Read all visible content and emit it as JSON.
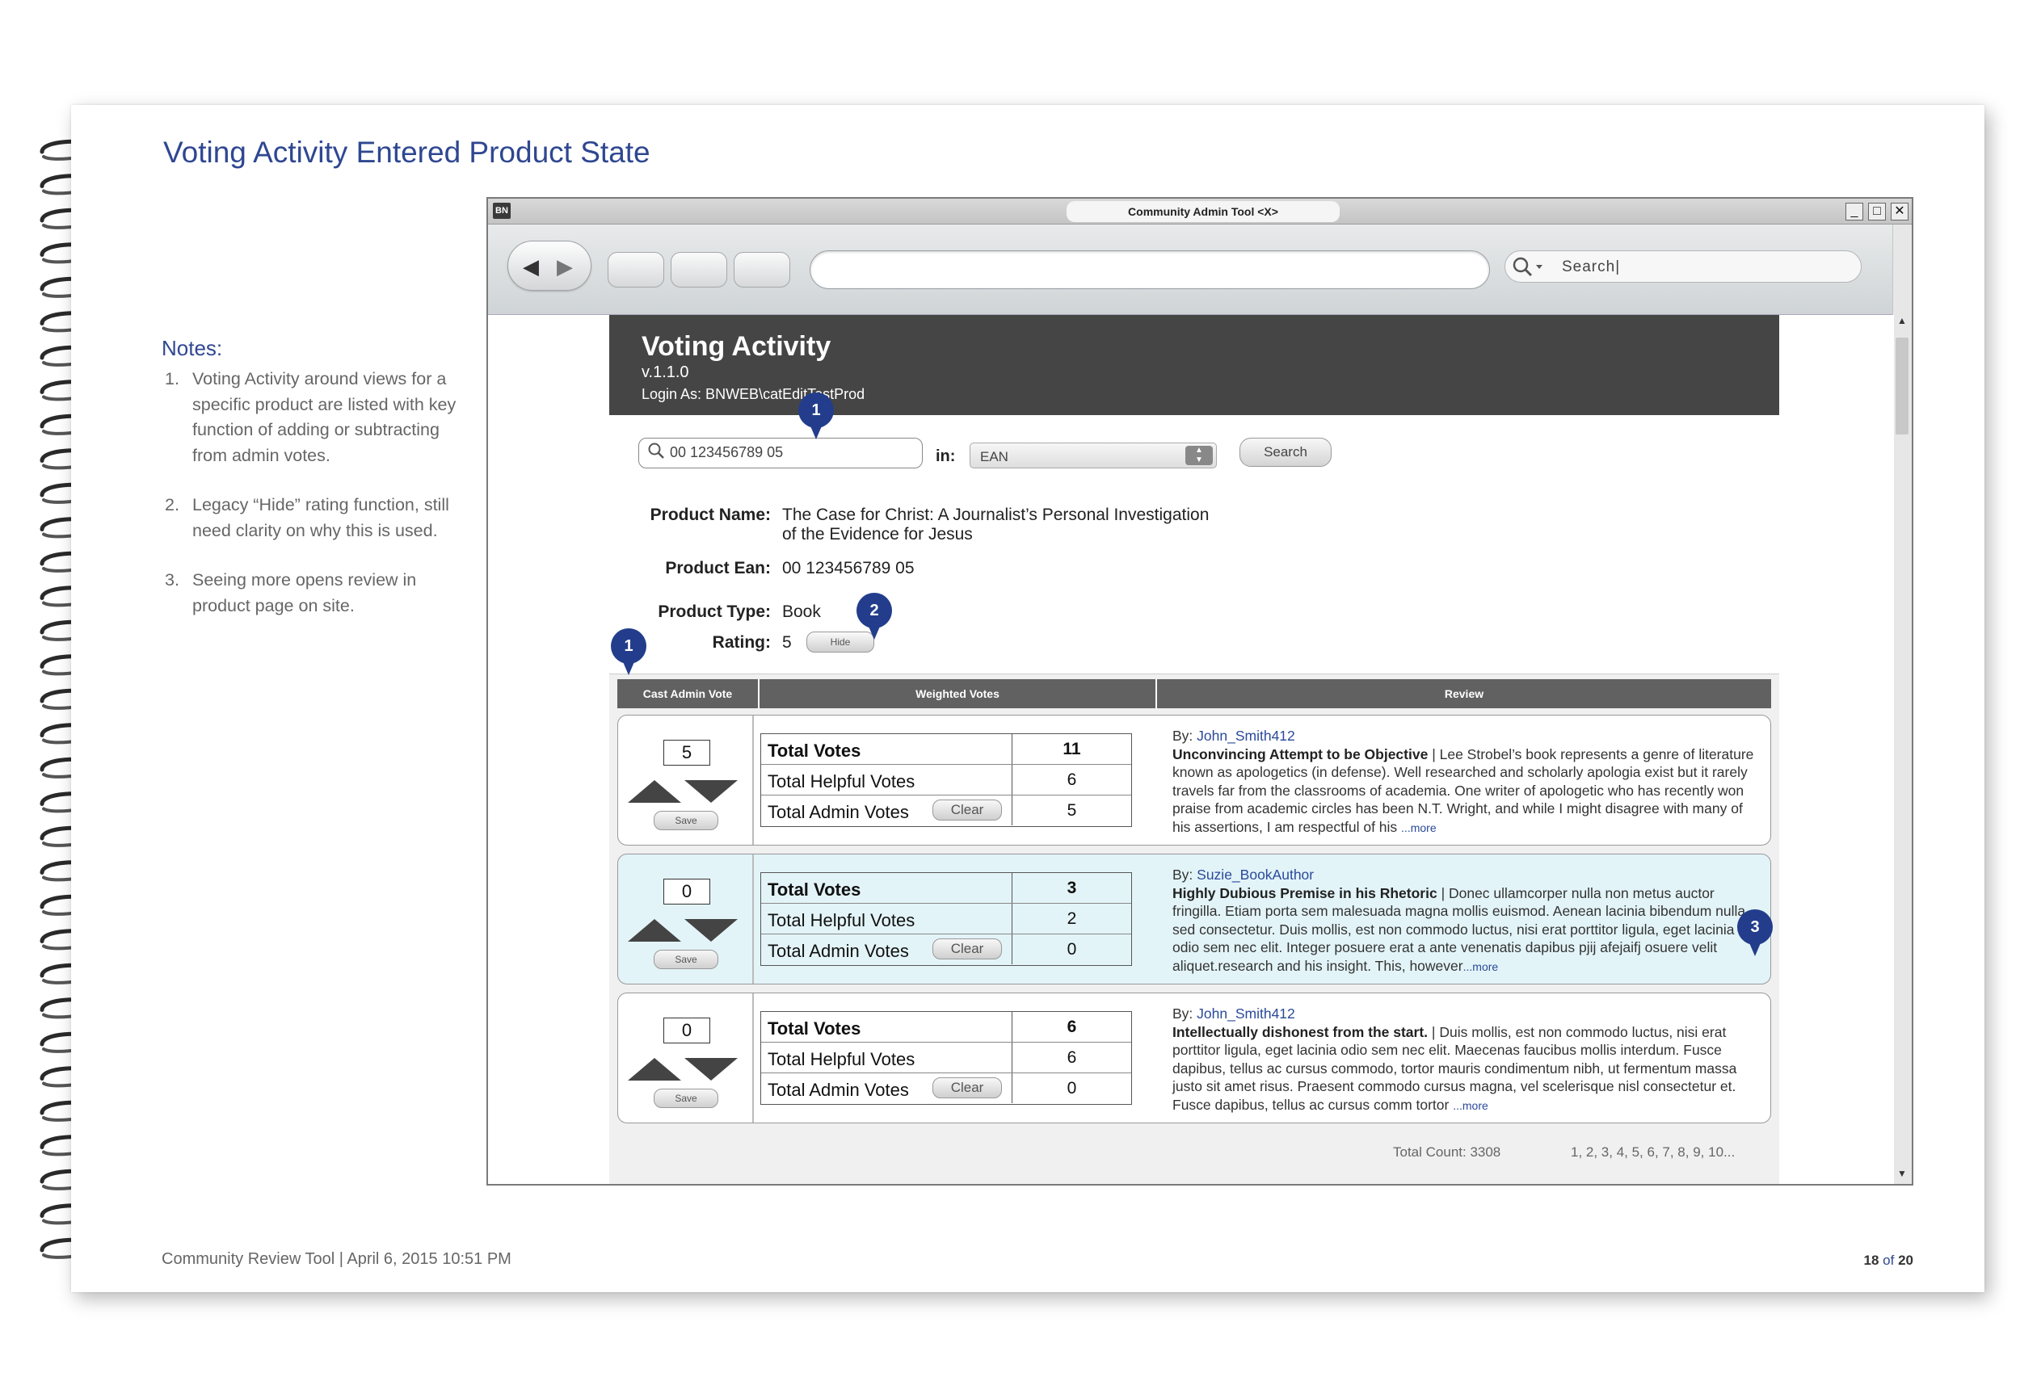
{
  "document": {
    "title": "Voting Activity Entered Product State",
    "notes_title": "Notes:",
    "notes": [
      {
        "num": "1.",
        "text": "Voting Activity around views for a specific product are listed with key function of adding or subtracting from admin votes."
      },
      {
        "num": "2.",
        "text": "Legacy “Hide” rating function, still need clarity on why this is used."
      },
      {
        "num": "3.",
        "text": "Seeing more opens review in product page on site."
      }
    ],
    "footer_left": "Community Review Tool | April 6, 2015 10:51 PM",
    "page_current": "18",
    "page_of": "of",
    "page_total": "20"
  },
  "window": {
    "app_icon": "BN",
    "title": "Community Admin Tool <X>",
    "minimize": "_",
    "maximize": "□",
    "close": "✕",
    "search_placeholder": "Search|"
  },
  "app": {
    "title": "Voting Activity",
    "version": "v.1.1.0",
    "login": "Login As: BNWEB\\catEditTestProd",
    "search_value": "00 123456789 05",
    "in_label": "in:",
    "search_type": "EAN",
    "search_button": "Search",
    "product_name_label": "Product Name:",
    "product_name_line1": "The Case for Christ: A Journalist’s Personal Investigation",
    "product_name_line2": "of the Evidence for Jesus",
    "product_ean_label": "Product Ean:",
    "product_ean": "00 123456789 05",
    "product_type_label": "Product Type:",
    "product_type": "Book",
    "rating_label": "Rating:",
    "rating": "5",
    "hide_button": "Hide",
    "columns": [
      "Cast Admin Vote",
      "Weighted Votes",
      "Review"
    ],
    "total_votes_label": "Total Votes",
    "helpful_votes_label": "Total Helpful Votes",
    "admin_votes_label": "Total Admin Votes",
    "clear_button": "Clear",
    "save_button": "Save",
    "by_prefix": "By: ",
    "more_link": "...more",
    "rows": [
      {
        "admin_vote": "5",
        "total_votes": "11",
        "helpful_votes": "6",
        "admin_votes": "5",
        "author": "John_Smith412",
        "headline": "Unconvincing Attempt to be Objective",
        "body": " | Lee Strobel’s book represents a genre of literature known as apologetics (in defense). Well researched and scholarly apologia exist but it rarely travels far from the classrooms of academia. One writer of apologetic who has recently won praise from academic circles has been N.T. Wright, and while I might disagree with many of his assertions, I am respectful of his "
      },
      {
        "admin_vote": "0",
        "total_votes": "3",
        "helpful_votes": "2",
        "admin_votes": "0",
        "author": "Suzie_BookAuthor",
        "headline": "Highly Dubious Premise in his Rhetoric",
        "body": " | Donec ullamcorper nulla non metus auctor fringilla. Etiam porta sem malesuada magna mollis euismod. Aenean lacinia bibendum nulla sed consectetur. Duis mollis, est non commodo luctus, nisi erat porttitor ligula, eget lacinia odio sem nec elit. Integer posuere erat a ante venenatis dapibus pjij afejaifj osuere velit aliquet.research and his insight. This, however"
      },
      {
        "admin_vote": "0",
        "total_votes": "6",
        "helpful_votes": "6",
        "admin_votes": "0",
        "author": "John_Smith412",
        "headline": "Intellectually dishonest from the start.",
        "body": " | Duis mollis, est non commodo luctus, nisi erat porttitor ligula, eget lacinia odio sem nec elit. Maecenas faucibus mollis interdum. Fusce dapibus, tellus ac cursus commodo, tortor mauris condimentum nibh, ut fermentum massa justo sit amet risus. Praesent commodo cursus magna, vel scelerisque nisl consectetur et. Fusce dapibus, tellus ac cursus comm tortor "
      }
    ],
    "total_count": "Total Count: 3308",
    "pager": "1, 2, 3, 4, 5, 6, 7, 8, 9, 10..."
  },
  "callouts": [
    "1",
    "1",
    "2",
    "3"
  ],
  "colors": {
    "accent_blue": "#2f4791",
    "callout_blue": "#233d8c",
    "header_dark": "#454545",
    "highlight_row": "#e3f4f8"
  },
  "icons": [
    "spiral-binding",
    "back-arrow-icon",
    "forward-arrow-icon",
    "search-icon",
    "minimize-icon",
    "maximize-icon",
    "close-icon",
    "vote-up-icon",
    "vote-down-icon",
    "dropdown-arrows-icon"
  ]
}
